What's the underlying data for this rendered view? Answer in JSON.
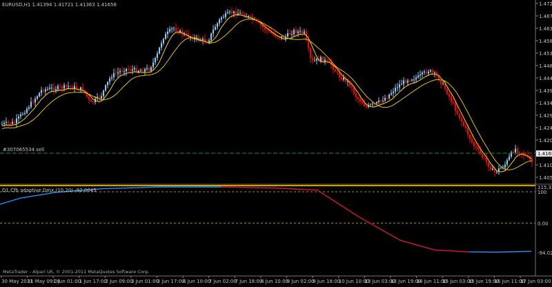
{
  "main_chart": {
    "header": "EURUSD,H1  1.41394 1.41721 1.41363 1.41658",
    "price_axis_labels": [
      "1.47265",
      "1.46760",
      "1.46300",
      "1.45830",
      "1.45350",
      "1.44870",
      "1.44400",
      "1.43920",
      "1.43450",
      "1.42970",
      "1.42490",
      "1.42020",
      "1.41540",
      "1.41070",
      "1.40590"
    ],
    "price_range": [
      1.4059,
      1.47265
    ],
    "order_line": {
      "label": "#307065534 sell",
      "price": 1.4164
    },
    "current_price": "1.41658",
    "colors": {
      "bull": "#87cefa",
      "bear": "#ff0000",
      "ma": "#ffd700",
      "order_line": "#1f8f1f"
    }
  },
  "indicator_panel": {
    "header": "D1 Cfb adaptive Dmx (10,20) -92.0045",
    "axis_labels": [
      "115.327",
      "100",
      "0.00",
      "-94.0286"
    ],
    "range": [
      -94.0286,
      115.327
    ],
    "levels": [
      100,
      0
    ],
    "colors": {
      "rising": "#1e90ff",
      "falling": "#dc143c",
      "level": "#b8860b"
    }
  },
  "time_axis": [
    "30 May 2011",
    "31 May 09:00",
    "1 Jun 01:00",
    "1 Jun 17:00",
    "2 Jun 09:00",
    "3 Jun 01:00",
    "3 Jun 17:00",
    "6 Jun 10:00",
    "7 Jun 02:00",
    "7 Jun 18:00",
    "8 Jun 10:00",
    "9 Jun 02:00",
    "9 Jun 18:00",
    "10 Jun 10:00",
    "13 Jun 03:00",
    "13 Jun 19:00",
    "14 Jun 11:00",
    "15 Jun 03:00",
    "15 Jun 19:00",
    "16 Jun 11:00",
    "17 Jun 03:00"
  ],
  "footer": "MetaTrader - Alpari UK, © 2001-2011 MetaQuotes Software Corp."
}
